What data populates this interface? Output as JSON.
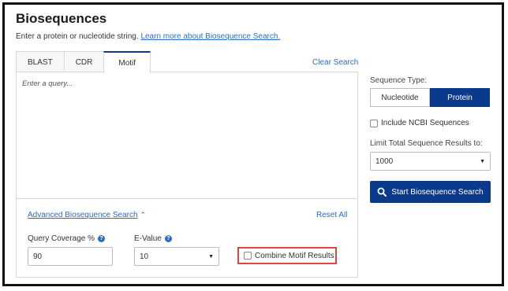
{
  "page": {
    "title": "Biosequences",
    "subtitle_text": "Enter a protein or nucleotide string.",
    "subtitle_link": "Learn more about Biosequence Search."
  },
  "tabs": [
    {
      "label": "BLAST",
      "active": false
    },
    {
      "label": "CDR",
      "active": false
    },
    {
      "label": "Motif",
      "active": true
    }
  ],
  "clear_search": "Clear Search",
  "query": {
    "placeholder": "Enter a query...",
    "value": ""
  },
  "advanced": {
    "link_label": "Advanced Biosequence Search",
    "reset_label": "Reset All",
    "query_coverage": {
      "label": "Query Coverage %",
      "value": "90"
    },
    "e_value": {
      "label": "E-Value",
      "value": "10"
    },
    "combine_motif": {
      "label": "Combine Motif Results",
      "checked": false
    }
  },
  "sidebar": {
    "sequence_type_label": "Sequence Type:",
    "sequence_types": [
      {
        "label": "Nucleotide",
        "selected": false
      },
      {
        "label": "Protein",
        "selected": true
      }
    ],
    "include_ncbi": {
      "label": "Include NCBI Sequences",
      "checked": false
    },
    "limit_label": "Limit Total Sequence Results to:",
    "limit_value": "1000",
    "start_button": "Start Biosequence Search"
  },
  "colors": {
    "primary": "#0b3a8c",
    "link": "#2b6cc4",
    "highlight": "#e0463c"
  }
}
